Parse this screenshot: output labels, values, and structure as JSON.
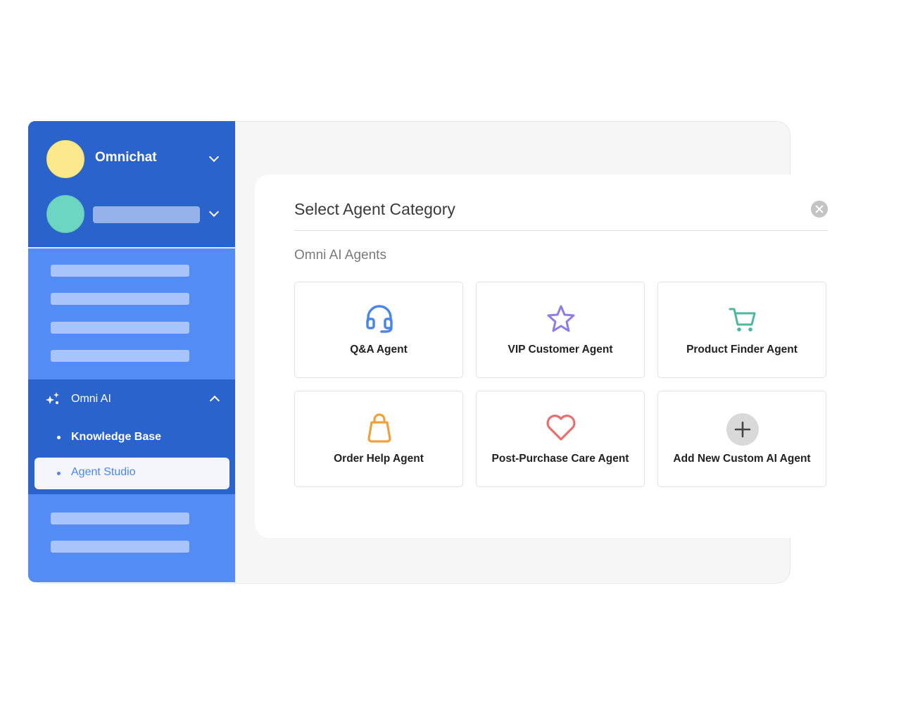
{
  "sidebar": {
    "org_name": "Omnichat",
    "section_title": "Omni AI",
    "items": [
      {
        "label": "Knowledge Base",
        "active": false
      },
      {
        "label": "Agent Studio",
        "active": true
      }
    ]
  },
  "dialog": {
    "title": "Select Agent Category",
    "section_label": "Omni AI Agents",
    "cards": [
      {
        "label": "Q&A Agent",
        "icon": "headset-icon",
        "color": "#4a86e8"
      },
      {
        "label": "VIP Customer Agent",
        "icon": "star-icon",
        "color": "#8f7ce8"
      },
      {
        "label": "Product Finder Agent",
        "icon": "cart-icon",
        "color": "#4ab9a0"
      },
      {
        "label": "Order Help Agent",
        "icon": "shopping-bag-icon",
        "color": "#f0a23a"
      },
      {
        "label": "Post-Purchase Care Agent",
        "icon": "heart-icon",
        "color": "#e86f6f"
      },
      {
        "label": "Add New Custom AI Agent",
        "icon": "plus-icon",
        "color": "#444444"
      }
    ]
  }
}
